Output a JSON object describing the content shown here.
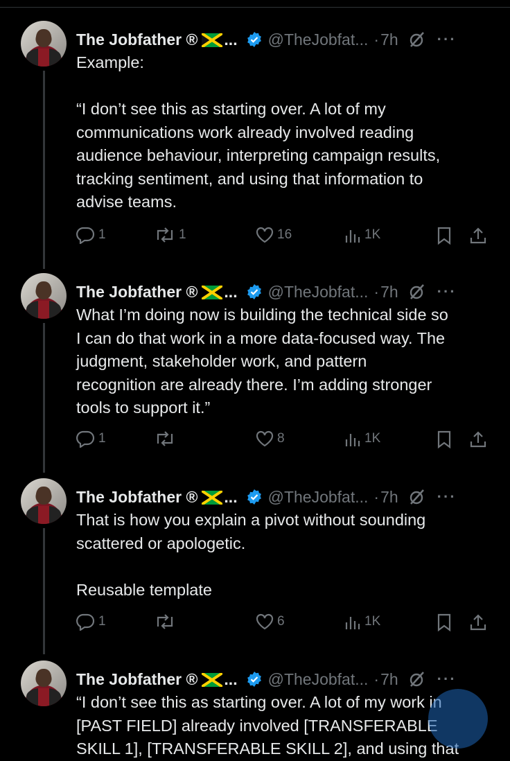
{
  "tweets": [
    {
      "name": "The Jobfather ®",
      "ellipsis": "...",
      "handle": "@TheJobfat...",
      "separator": "·",
      "time": "7h",
      "text": "Example:\n\n“I don’t see this as starting over. A lot of my\ncommunications work already involved reading\naudience behaviour, interpreting campaign results,\ntracking sentiment, and using that information to\nadvise teams.",
      "replies": "1",
      "reposts": "1",
      "likes": "16",
      "views": "1K"
    },
    {
      "name": "The Jobfather ®",
      "ellipsis": "...",
      "handle": "@TheJobfat...",
      "separator": "·",
      "time": "7h",
      "text": "What I’m doing now is building the technical side so\nI can do that work in a more data-focused way. The\njudgment, stakeholder work, and pattern\nrecognition are already there. I’m adding stronger\ntools to support it.”",
      "replies": "1",
      "reposts": "",
      "likes": "8",
      "views": "1K"
    },
    {
      "name": "The Jobfather ®",
      "ellipsis": "...",
      "handle": "@TheJobfat...",
      "separator": "·",
      "time": "7h",
      "text": "That is how you explain a pivot without sounding\nscattered or apologetic.\n\nReusable template",
      "replies": "1",
      "reposts": "",
      "likes": "6",
      "views": "1K"
    },
    {
      "name": "The Jobfather ®",
      "ellipsis": "...",
      "handle": "@TheJobfat...",
      "separator": "·",
      "time": "7h",
      "text": "“I don’t see this as starting over. A lot of my work in\n[PAST FIELD] already involved [TRANSFERABLE\nSKILL 1], [TRANSFERABLE SKILL 2], and using that"
    }
  ],
  "colors": {
    "background": "#000000",
    "text": "#e7e9ea",
    "muted": "#71767b",
    "verified": "#1d9bf0",
    "thread_line": "#333639"
  },
  "icons": [
    "jamaica-flag-icon",
    "verified-badge-icon",
    "grok-icon",
    "more-icon",
    "reply-icon",
    "repost-icon",
    "like-icon",
    "views-icon",
    "bookmark-icon",
    "share-icon"
  ]
}
